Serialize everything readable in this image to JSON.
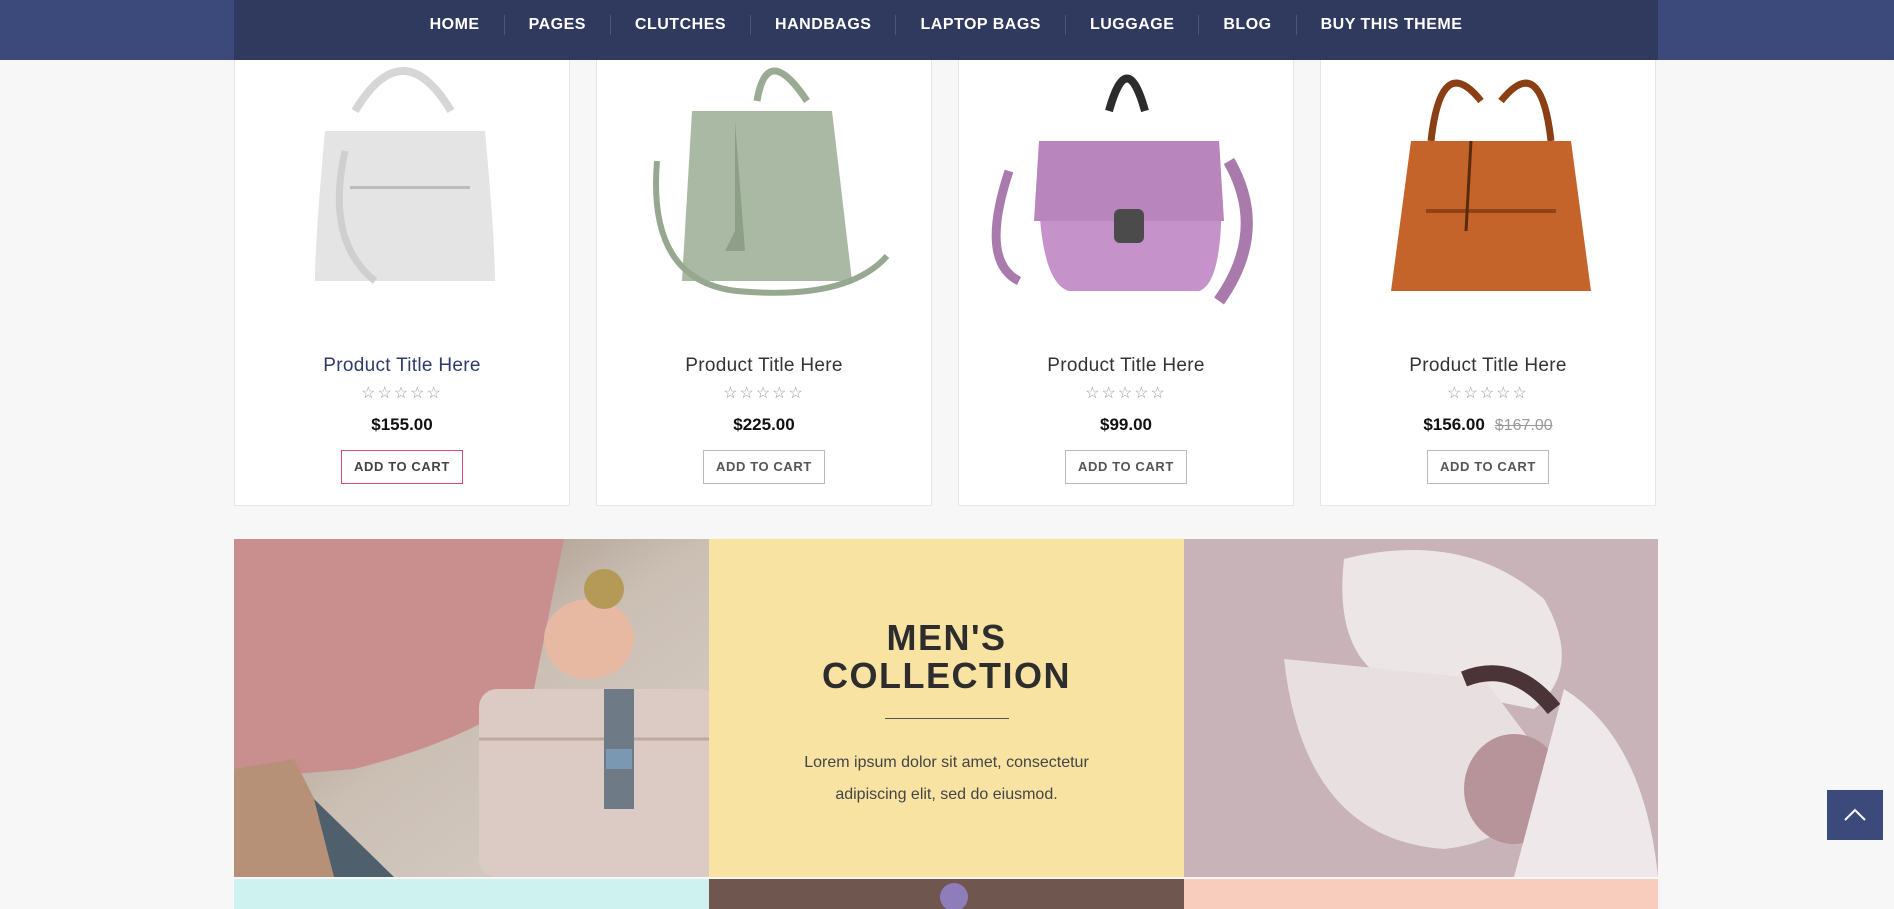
{
  "nav": {
    "items": [
      "HOME",
      "PAGES",
      "CLUTCHES",
      "HANDBAGS",
      "LAPTOP BAGS",
      "LUGGAGE",
      "BLOG",
      "BUY THIS THEME"
    ]
  },
  "products": [
    {
      "title": "Product Title Here",
      "stars": "☆☆☆☆☆",
      "price": "$155.00",
      "old_price": "",
      "button": "ADD TO CART",
      "bag_color": "#e3e3e3"
    },
    {
      "title": "Product Title Here",
      "stars": "☆☆☆☆☆",
      "price": "$225.00",
      "old_price": "",
      "button": "ADD TO CART",
      "bag_color": "#a8b8a2"
    },
    {
      "title": "Product Title Here",
      "stars": "☆☆☆☆☆",
      "price": "$99.00",
      "old_price": "",
      "button": "ADD TO CART",
      "bag_color": "#c592c9"
    },
    {
      "title": "Product Title Here",
      "stars": "☆☆☆☆☆",
      "price": "$156.00",
      "old_price": "$167.00",
      "button": "ADD TO CART",
      "bag_color": "#c4642a"
    }
  ],
  "banner": {
    "title_line1": "MEN'S",
    "title_line2": "COLLECTION",
    "text": "Lorem ipsum dolor sit amet, consectetur adipiscing elit, sed do eiusmod."
  },
  "scroll_top_icon": "chevron-up-icon",
  "colors": {
    "nav": "#2f3a5e",
    "accent_pink": "#d64b7b",
    "mens_bg": "#f8e3a3",
    "tile_mint": "#cdf2ef",
    "tile_peach": "#f9cdbd"
  }
}
